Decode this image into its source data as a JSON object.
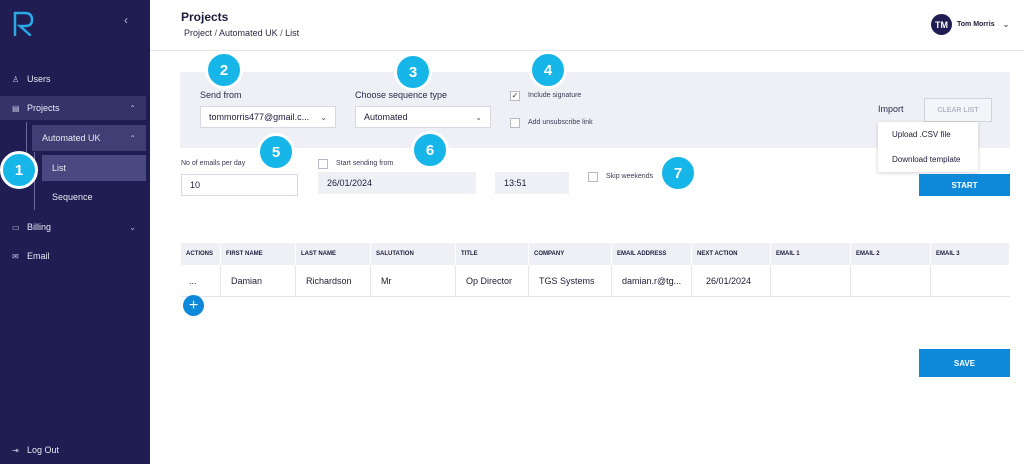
{
  "sidebar": {
    "items": [
      {
        "label": "Users",
        "icon": "user-icon"
      },
      {
        "label": "Projects",
        "icon": "folder-icon"
      },
      {
        "label": "Automated UK"
      },
      {
        "label": "List"
      },
      {
        "label": "Sequence"
      },
      {
        "label": "Billing",
        "icon": "card-icon"
      },
      {
        "label": "Email",
        "icon": "mail-icon"
      }
    ],
    "logout": "Log Out"
  },
  "header": {
    "title": "Projects",
    "breadcrumb": [
      "Project",
      "Automated UK",
      "List"
    ],
    "user_initials": "TM",
    "user_name": "Tom Morris"
  },
  "form": {
    "send_from_label": "Send from",
    "send_from_value": "tommorris477@gmail.c...",
    "sequence_type_label": "Choose sequence type",
    "sequence_type_value": "Automated",
    "include_signature": "Include signature",
    "add_unsubscribe": "Add unsubscribe link",
    "import_label": "Import",
    "clear_list": "CLEAR LIST",
    "import_options": [
      "Upload .CSV file",
      "Download template"
    ],
    "emails_per_day_label": "No of emails per day",
    "emails_per_day_value": "10",
    "start_sending_label": "Start sending from",
    "start_date": "26/01/2024",
    "start_time": "13:51",
    "skip_weekends": "Skip weekends",
    "start_button": "START",
    "save_button": "SAVE"
  },
  "table": {
    "headers": [
      "ACTIONS",
      "FIRST NAME",
      "LAST NAME",
      "SALUTATION",
      "TITLE",
      "COMPANY",
      "EMAIL ADDRESS",
      "NEXT ACTION",
      "EMAIL 1",
      "EMAIL 2",
      "EMAIL 3"
    ],
    "rows": [
      [
        "...",
        "Damian",
        "Richardson",
        "Mr",
        "Op Director",
        "TGS Systems",
        "damian.r@tg...",
        "26/01/2024",
        "",
        "",
        ""
      ]
    ]
  },
  "callouts": [
    "1",
    "2",
    "3",
    "4",
    "5",
    "6",
    "7"
  ],
  "colors": {
    "sidebar": "#1f1d52",
    "accent": "#0e88d8",
    "callout": "#17b6e8"
  }
}
